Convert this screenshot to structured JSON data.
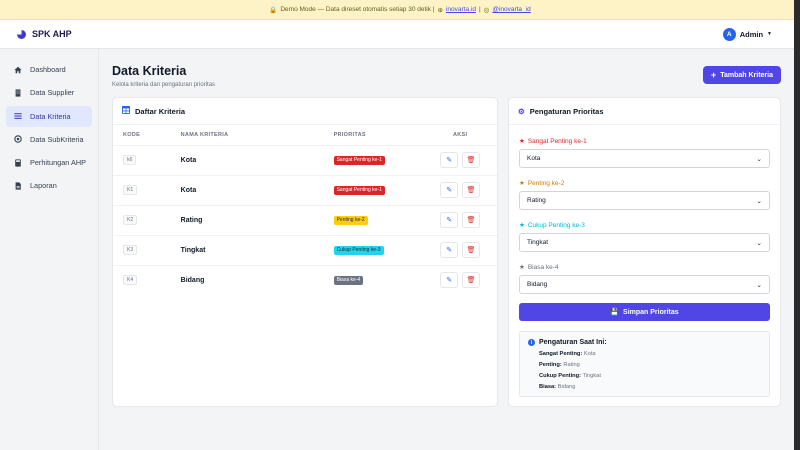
{
  "banner": {
    "text": "Demo Mode — Data direset otomatis setiap 30 detik |",
    "link1": "inovarta.id",
    "separator": "|",
    "link2": "@inovarta_id"
  },
  "brand": {
    "name": "SPK AHP"
  },
  "user": {
    "initial": "A",
    "name": "Admin"
  },
  "sidebar": {
    "items": [
      {
        "label": "Dashboard",
        "icon": "home-icon"
      },
      {
        "label": "Data Supplier",
        "icon": "building-icon"
      },
      {
        "label": "Data Kriteria",
        "icon": "list-icon",
        "active": true
      },
      {
        "label": "Data SubKriteria",
        "icon": "layers-icon"
      },
      {
        "label": "Perhitungan AHP",
        "icon": "calculator-icon"
      },
      {
        "label": "Laporan",
        "icon": "file-icon"
      }
    ]
  },
  "page": {
    "title": "Data Kriteria",
    "subtitle": "Kelola kriteria dan pengaturan prioritas",
    "add_button": "Tambah Kriteria"
  },
  "table": {
    "title": "Daftar Kriteria",
    "columns": [
      "KODE",
      "NAMA KRITERIA",
      "PRIORITAS",
      "AKSI"
    ],
    "rows": [
      {
        "code": "k6",
        "name": "Kota",
        "priority": "Sangat Penting ke-1",
        "color": "#dc2626"
      },
      {
        "code": "K1",
        "name": "Kota",
        "priority": "Sangat Penting ke-1",
        "color": "#dc2626"
      },
      {
        "code": "K2",
        "name": "Rating",
        "priority": "Penting ke-2",
        "color": "#facc15"
      },
      {
        "code": "K3",
        "name": "Tingkat",
        "priority": "Cukup Penting ke-3",
        "color": "#22d3ee"
      },
      {
        "code": "K4",
        "name": "Bidang",
        "priority": "Biasa ke-4",
        "color": "#6b7280"
      }
    ]
  },
  "priority_settings": {
    "title": "Pengaturan Prioritas",
    "fields": [
      {
        "label": "Sangat Penting ke-1",
        "value": "Kota",
        "color": "#dc2626"
      },
      {
        "label": "Penting ke-2",
        "value": "Rating",
        "color": "#d97706"
      },
      {
        "label": "Cukup Penting ke-3",
        "value": "Tingkat",
        "color": "#06b6d4"
      },
      {
        "label": "Biasa ke-4",
        "value": "Bidang",
        "color": "#6b7280"
      }
    ],
    "save_button": "Simpan Prioritas",
    "current": {
      "title": "Pengaturan Saat Ini:",
      "rows": [
        {
          "key": "Sangat Penting:",
          "value": "Kota"
        },
        {
          "key": "Penting:",
          "value": "Rating"
        },
        {
          "key": "Cukup Penting:",
          "value": "Tingkat"
        },
        {
          "key": "Biasa:",
          "value": "Bidang"
        }
      ]
    }
  }
}
